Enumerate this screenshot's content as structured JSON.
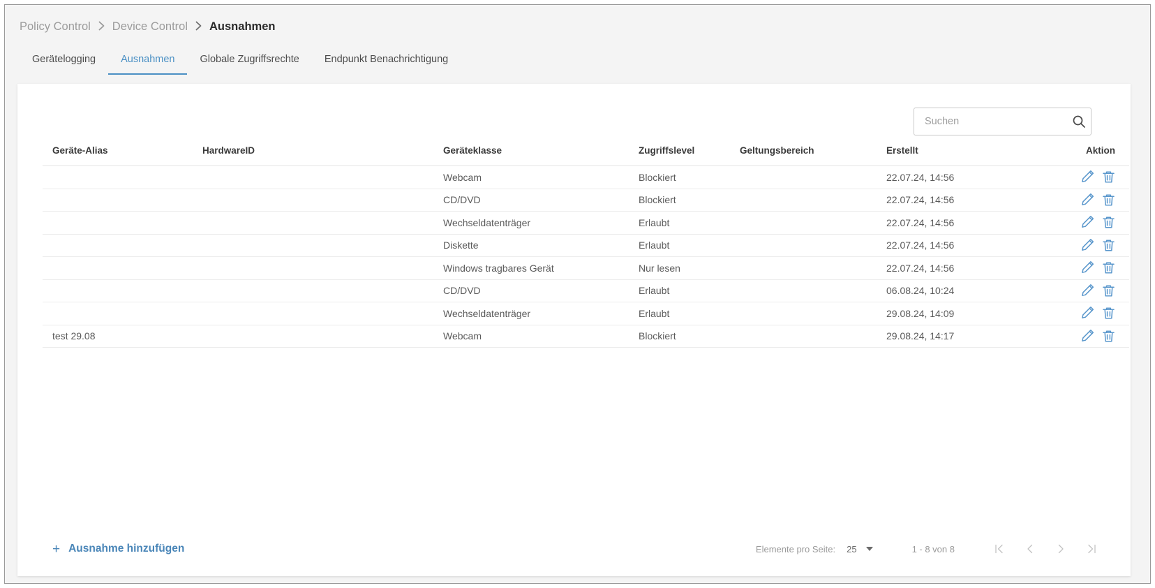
{
  "breadcrumb": {
    "items": [
      {
        "label": "Policy Control",
        "current": false
      },
      {
        "label": "Device Control",
        "current": false
      },
      {
        "label": "Ausnahmen",
        "current": true
      }
    ]
  },
  "tabs": [
    {
      "label": "Gerätelogging",
      "active": false
    },
    {
      "label": "Ausnahmen",
      "active": true
    },
    {
      "label": "Globale Zugriffsrechte",
      "active": false
    },
    {
      "label": "Endpunkt Benachrichtigung",
      "active": false
    }
  ],
  "search": {
    "placeholder": "Suchen",
    "value": "",
    "icon": "search-icon"
  },
  "table": {
    "columns": [
      "Geräte-Alias",
      "HardwareID",
      "Geräteklasse",
      "Zugriffslevel",
      "Geltungsbereich",
      "Erstellt",
      "Aktion"
    ],
    "rows": [
      {
        "alias": "",
        "hardware_id": "",
        "device_class": "Webcam",
        "access_level": "Blockiert",
        "scope": "",
        "created": "22.07.24, 14:56"
      },
      {
        "alias": "",
        "hardware_id": "",
        "device_class": "CD/DVD",
        "access_level": "Blockiert",
        "scope": "",
        "created": "22.07.24, 14:56"
      },
      {
        "alias": "",
        "hardware_id": "",
        "device_class": "Wechseldatenträger",
        "access_level": "Erlaubt",
        "scope": "",
        "created": "22.07.24, 14:56"
      },
      {
        "alias": "",
        "hardware_id": "",
        "device_class": "Diskette",
        "access_level": "Erlaubt",
        "scope": "",
        "created": "22.07.24, 14:56"
      },
      {
        "alias": "",
        "hardware_id": "",
        "device_class": "Windows tragbares Gerät",
        "access_level": "Nur lesen",
        "scope": "",
        "created": "22.07.24, 14:56"
      },
      {
        "alias": "",
        "hardware_id": "",
        "device_class": "CD/DVD",
        "access_level": "Erlaubt",
        "scope": "",
        "created": "06.08.24, 10:24"
      },
      {
        "alias": "",
        "hardware_id": "",
        "device_class": "Wechseldatenträger",
        "access_level": "Erlaubt",
        "scope": "",
        "created": "29.08.24, 14:09"
      },
      {
        "alias": "test 29.08",
        "hardware_id": "",
        "device_class": "Webcam",
        "access_level": "Blockiert",
        "scope": "",
        "created": "29.08.24, 14:17"
      }
    ],
    "row_action_icons": [
      "edit-pencil-icon",
      "delete-trash-icon"
    ]
  },
  "footer": {
    "add_label": "Ausnahme hinzufügen",
    "add_icon": "plus-icon",
    "items_per_page_label": "Elemente pro Seite:",
    "items_per_page_value": "25",
    "range_label": "1 - 8 von 8",
    "pagination_icons": [
      "first-page-icon",
      "previous-page-icon",
      "next-page-icon",
      "last-page-icon"
    ]
  },
  "colors": {
    "accent": "#4a90c4",
    "link": "#4a86b8",
    "icon_blue": "#5a97cc",
    "page_bg": "#f4f4f4",
    "card_bg": "#ffffff",
    "muted_text": "#9a9a9a"
  }
}
